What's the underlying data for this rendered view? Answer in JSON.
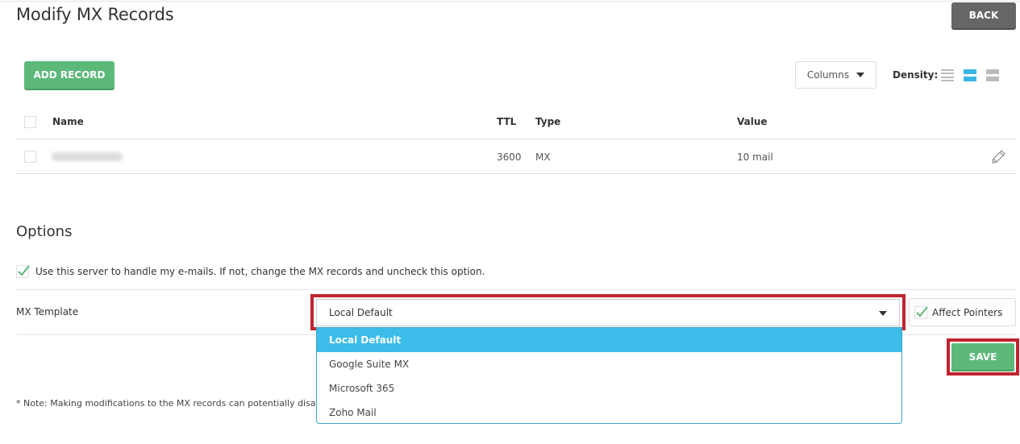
{
  "page": {
    "title": "Modify MX Records",
    "back_label": "BACK"
  },
  "toolbar": {
    "add_record_label": "ADD RECORD",
    "columns_label": "Columns",
    "density_label": "Density:",
    "density_options": [
      "compact",
      "default",
      "comfortable"
    ],
    "density_selected": "default"
  },
  "table": {
    "headers": {
      "name": "Name",
      "ttl": "TTL",
      "type": "Type",
      "value": "Value"
    },
    "rows": [
      {
        "name": "(blurred)",
        "ttl": "3600",
        "type": "MX",
        "value": "10 mail"
      }
    ]
  },
  "options": {
    "title": "Options",
    "use_server_label": "Use this server to handle my e-mails. If not, change the MX records and uncheck this option.",
    "use_server_checked": true,
    "mx_template_label": "MX Template",
    "mx_template_value": "Local Default",
    "mx_template_options": [
      "Local Default",
      "Google Suite MX",
      "Microsoft 365",
      "Zoho Mail"
    ],
    "affect_pointers_label": "Affect Pointers",
    "affect_pointers_checked": true,
    "save_label": "SAVE",
    "note": "* Note: Making modifications to the MX records can potentially disable"
  },
  "colors": {
    "primary_green": "#5cb97a",
    "back_gray": "#666666",
    "accent_blue": "#3bbce9",
    "highlight_red": "#c0242e"
  }
}
